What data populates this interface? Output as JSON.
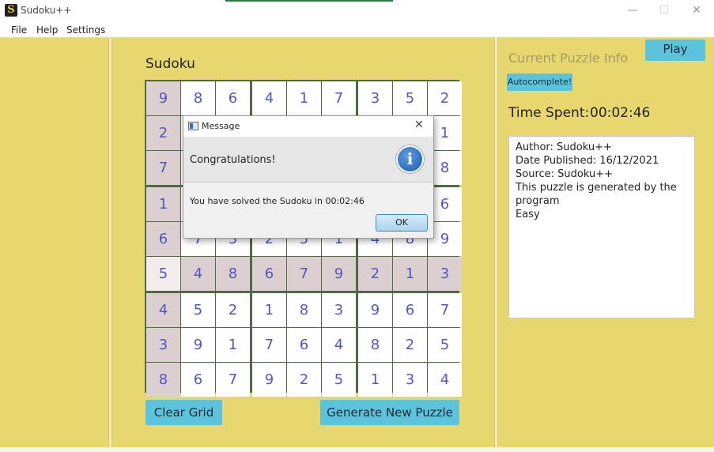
{
  "window": {
    "icon_letter": "S",
    "title": "Sudoku++",
    "minimize": "—",
    "maximize": "☐",
    "close": "✕"
  },
  "menu": {
    "items": [
      "File",
      "Help",
      "Settings"
    ]
  },
  "center": {
    "title": "Sudoku",
    "clear_button": "Clear Grid",
    "generate_button": "Generate New Puzzle"
  },
  "grid": {
    "values": [
      [
        9,
        8,
        6,
        4,
        1,
        7,
        3,
        5,
        2
      ],
      [
        2,
        null,
        null,
        null,
        null,
        null,
        null,
        null,
        1
      ],
      [
        7,
        null,
        null,
        null,
        null,
        null,
        null,
        null,
        8
      ],
      [
        1,
        null,
        null,
        null,
        null,
        null,
        null,
        null,
        6
      ],
      [
        6,
        7,
        3,
        2,
        5,
        1,
        4,
        8,
        9
      ],
      [
        5,
        4,
        8,
        6,
        7,
        9,
        2,
        1,
        3
      ],
      [
        4,
        5,
        2,
        1,
        8,
        3,
        9,
        6,
        7
      ],
      [
        3,
        9,
        1,
        7,
        6,
        4,
        8,
        2,
        5
      ],
      [
        8,
        6,
        7,
        9,
        2,
        5,
        1,
        3,
        4
      ]
    ],
    "given_columns_all_rows": [
      0
    ],
    "given_rows_all_cols": [
      5
    ],
    "selected_cell": [
      5,
      0
    ],
    "colors": {
      "given": "#dccfd0",
      "empty": "#ffffff",
      "selected": "#f3ecec",
      "digit": "#5355c8"
    }
  },
  "right": {
    "title": "Current Puzzle Info",
    "play_button": "Play",
    "autocomplete_button": "Autocomplete!",
    "time_label": "Time Spent:",
    "time_value": "00:02:46",
    "info_lines": [
      "Author: Sudoku++",
      "Date Published: 16/12/2021",
      "Source: Sudoku++",
      "This puzzle is generated by the",
      "program",
      "Easy"
    ]
  },
  "dialog": {
    "title": "Message",
    "close": "✕",
    "header": "Congratulations!",
    "icon_glyph": "i",
    "message": "You have solved the Sudoku in 00:02:46",
    "ok_button": "OK"
  },
  "theme": {
    "pane_bg": "#e8d76f",
    "accent_button": "#5bc3dc"
  }
}
